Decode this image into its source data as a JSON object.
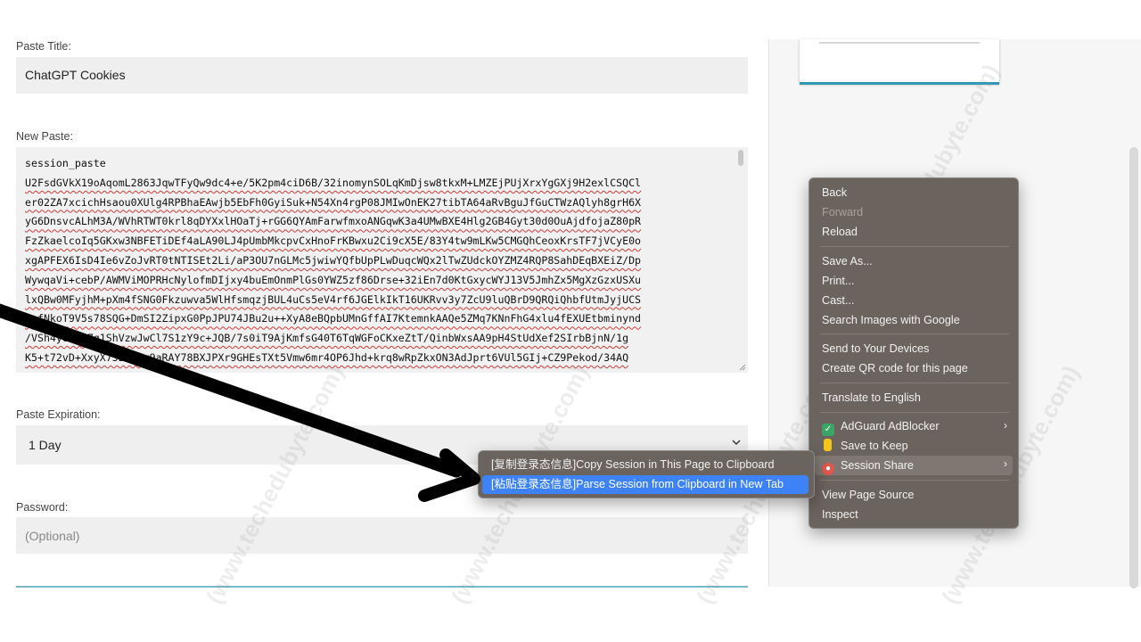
{
  "form": {
    "title_label": "Paste Title:",
    "title_value": "ChatGPT Cookies",
    "paste_label": "New Paste:",
    "paste_lines": [
      "session_paste",
      "U2FsdGVkX19oAqomL2863JqwTFyQw9dc4+e/5K2pm4ciD6B/32inomynSOLqKmDjsw8tkxM+LMZEjPUjXrxYgGXj9H2exlCSQCl",
      "er02ZA7xcichHsaou0XUlg4RPBhaEAwjb5EbFh0GyiSuk+N54Xn4rgP08JMIwOnEK27tibTA64aRvBguJfGuCTWzAQlyh8grH6X",
      "yG6DnsvcALhM3A/WVhRTWT0krl8qDYXxlHOaTj+rGG6QYAmFarwfmxoANGqwK3a4UMwBXE4Hlg2GB4Gyt30d0OuAjdfojaZ80pR",
      "FzZkaelcoIq5GKxw3NBFETiDEf4aLA90LJ4pUmbMkcpvCxHnoFrKBwxu2Ci9cX5E/83Y4tw9mLKw5CMGQhCeoxKrsTF7jVCyE0o",
      "xgAPFEX6IsD4Ie6vZoJvRT0tNTISEt2Li/aP3OU7nGLMc5jwiwYQfbUpPLwDuqcWQx2lTwZUdckOYZMZ4RQP8SahDEqBXEiZ/Dp",
      "WywqaVi+cebP/AWMViMOPRHcNylofmDIjxy4buEmOnmPlGs0YWZ5zf86Drse+32iEn7d0KtGxycWYJ13V5JmhZx5MgXzGzxUSXu",
      "lxQBw0MFyjhM+pXm4fSNG0Fkzuwva5WlHfsmqzjBUL4uCs5eV4rf6JGElkIkT16UKRvv3y7ZcU9luQBrD9QRQiQhbfUtmJyjUCS",
      "zafNkoT9V5s78SQG+DmSI2ZipxG0PpJPU74JBu2u++XyA8eBQpbUMnGffAI7KtemnkAAQe5ZMq7KNnFhG4xlu4fEXUEtbminynd",
      "/VSh4yO0JJZq1ShVzwJwCl7S1zY9c+JQB/7s0iT9AjKmfsG40T6TqWGFoCKxeZtT/QinbWxsAA9pH4StUdXef2SIrbBjnN/1g",
      "K5+t72vD+XxyX75BXSwy9aRAY78BXJPXr9GHEsTXt5Vmw6mr4OP6Jhd+krq8wRpZkxON3AdJprt6VUl5GIj+CZ9Pekod/34AQ"
    ],
    "expiration_label": "Paste Expiration:",
    "expiration_value": "1 Day",
    "password_label": "Password:",
    "password_placeholder": "(Optional)"
  },
  "context_menu": {
    "back": "Back",
    "forward": "Forward",
    "reload": "Reload",
    "save_as": "Save As...",
    "print": "Print...",
    "cast": "Cast...",
    "search_images": "Search Images with Google",
    "send_devices": "Send to Your Devices",
    "qr_code": "Create QR code for this page",
    "translate": "Translate to English",
    "adguard": "AdGuard AdBlocker",
    "save_keep": "Save to Keep",
    "session_share": "Session Share",
    "view_source": "View Page Source",
    "inspect": "Inspect"
  },
  "submenu": {
    "copy_session": "[复制登录态信息]Copy Session in This Page to Clipboard",
    "parse_session": "[粘贴登录态信息]Parse Session from Clipboard in New Tab"
  },
  "watermark": "(www.techedubyte.com)",
  "colors": {
    "menu_bg": "#6b635d",
    "highlight": "#3d83f7",
    "accent_line": "#2c9ab4"
  }
}
